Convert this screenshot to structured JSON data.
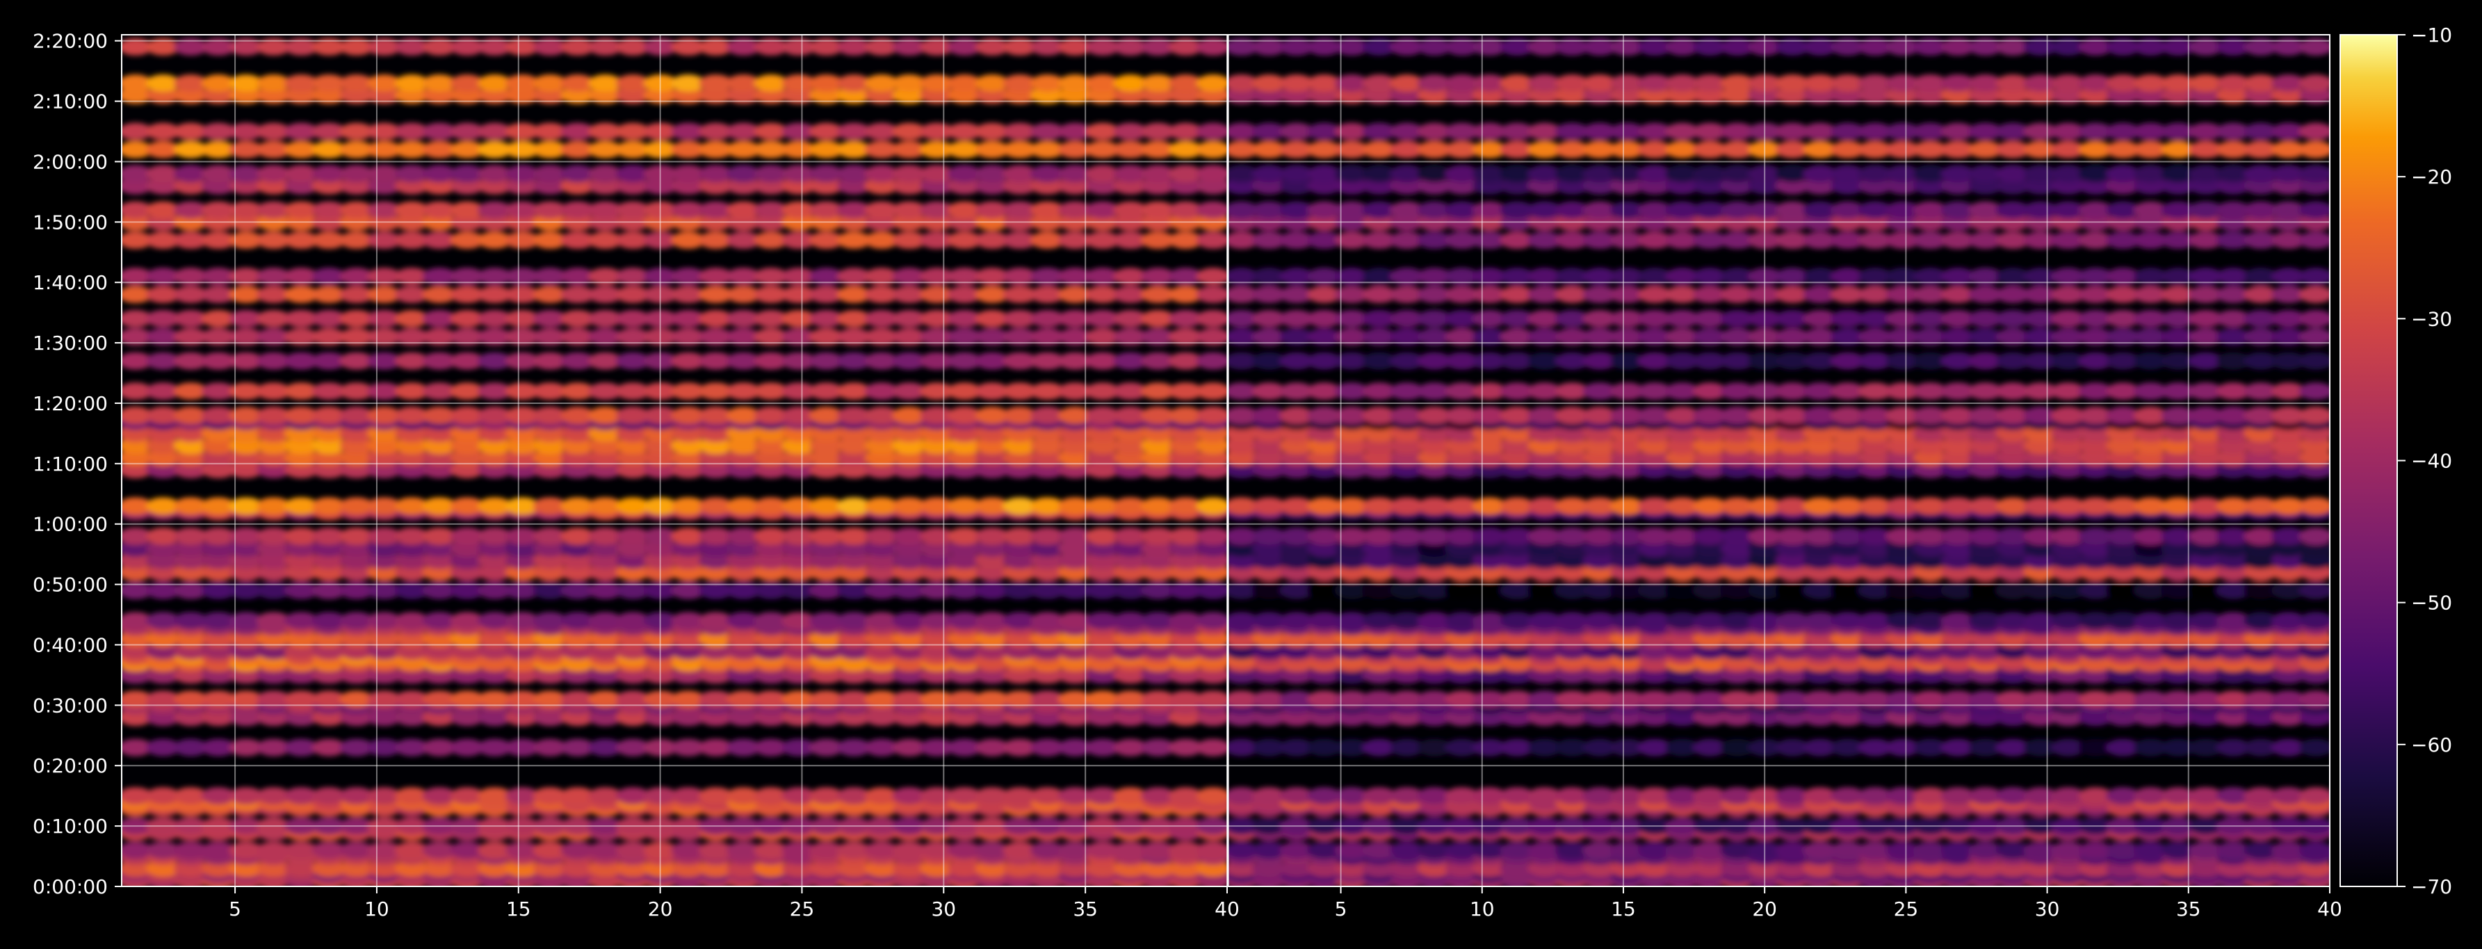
{
  "chart_data": {
    "type": "heatmap",
    "panels": 2,
    "x_ticks": [
      "5",
      "10",
      "15",
      "20",
      "25",
      "30",
      "35",
      "40"
    ],
    "x_tick_values": [
      5,
      10,
      15,
      20,
      25,
      30,
      35,
      40
    ],
    "xlim": [
      1,
      40
    ],
    "y_ticks": [
      "0:00:00",
      "0:10:00",
      "0:20:00",
      "0:30:00",
      "0:40:00",
      "0:50:00",
      "1:00:00",
      "1:10:00",
      "1:20:00",
      "1:30:00",
      "1:40:00",
      "1:50:00",
      "2:00:00",
      "2:10:00",
      "2:20:00"
    ],
    "ylim_minutes": [
      0,
      141
    ],
    "colorbar": {
      "ticks": [
        "−10",
        "−20",
        "−30",
        "−40",
        "−50",
        "−60",
        "−70"
      ],
      "tick_values": [
        -10,
        -20,
        -30,
        -40,
        -50,
        -60,
        -70
      ],
      "range": [
        -70,
        -10
      ],
      "colormap": "inferno"
    },
    "grid": true,
    "background": "#000000",
    "row_minutes": [
      1,
      2,
      3,
      5,
      6,
      9,
      10,
      13,
      14,
      15,
      23,
      28,
      30,
      31,
      35,
      37,
      38,
      39,
      41,
      43,
      44,
      49,
      52,
      54,
      56,
      58,
      62,
      63,
      69,
      71,
      73,
      75,
      77,
      78,
      82,
      87,
      91,
      94,
      98,
      101,
      107,
      110,
      112,
      116,
      118,
      122,
      125,
      131,
      133,
      139
    ],
    "panel_left_row_levels": [
      -35,
      -40,
      -28,
      -36,
      -38,
      -33,
      -40,
      -30,
      -27,
      -33,
      -45,
      -38,
      -42,
      -30,
      -40,
      -24,
      -24,
      -40,
      -25,
      -38,
      -45,
      -52,
      -30,
      -40,
      -45,
      -36,
      -35,
      -21,
      -38,
      -28,
      -22,
      -25,
      -48,
      -30,
      -33,
      -42,
      -38,
      -35,
      -30,
      -40,
      -30,
      -28,
      -35,
      -36,
      -42,
      -22,
      -35,
      -24,
      -22,
      -35
    ],
    "panel_right_row_levels": [
      -40,
      -50,
      -38,
      -48,
      -52,
      -40,
      -55,
      -38,
      -33,
      -42,
      -60,
      -48,
      -56,
      -42,
      -52,
      -28,
      -30,
      -52,
      -30,
      -48,
      -55,
      -65,
      -32,
      -58,
      -60,
      -48,
      -52,
      -28,
      -52,
      -33,
      -30,
      -32,
      -62,
      -40,
      -42,
      -58,
      -50,
      -48,
      -40,
      -55,
      -45,
      -42,
      -50,
      -52,
      -58,
      -25,
      -45,
      -35,
      -35,
      -50
    ]
  }
}
